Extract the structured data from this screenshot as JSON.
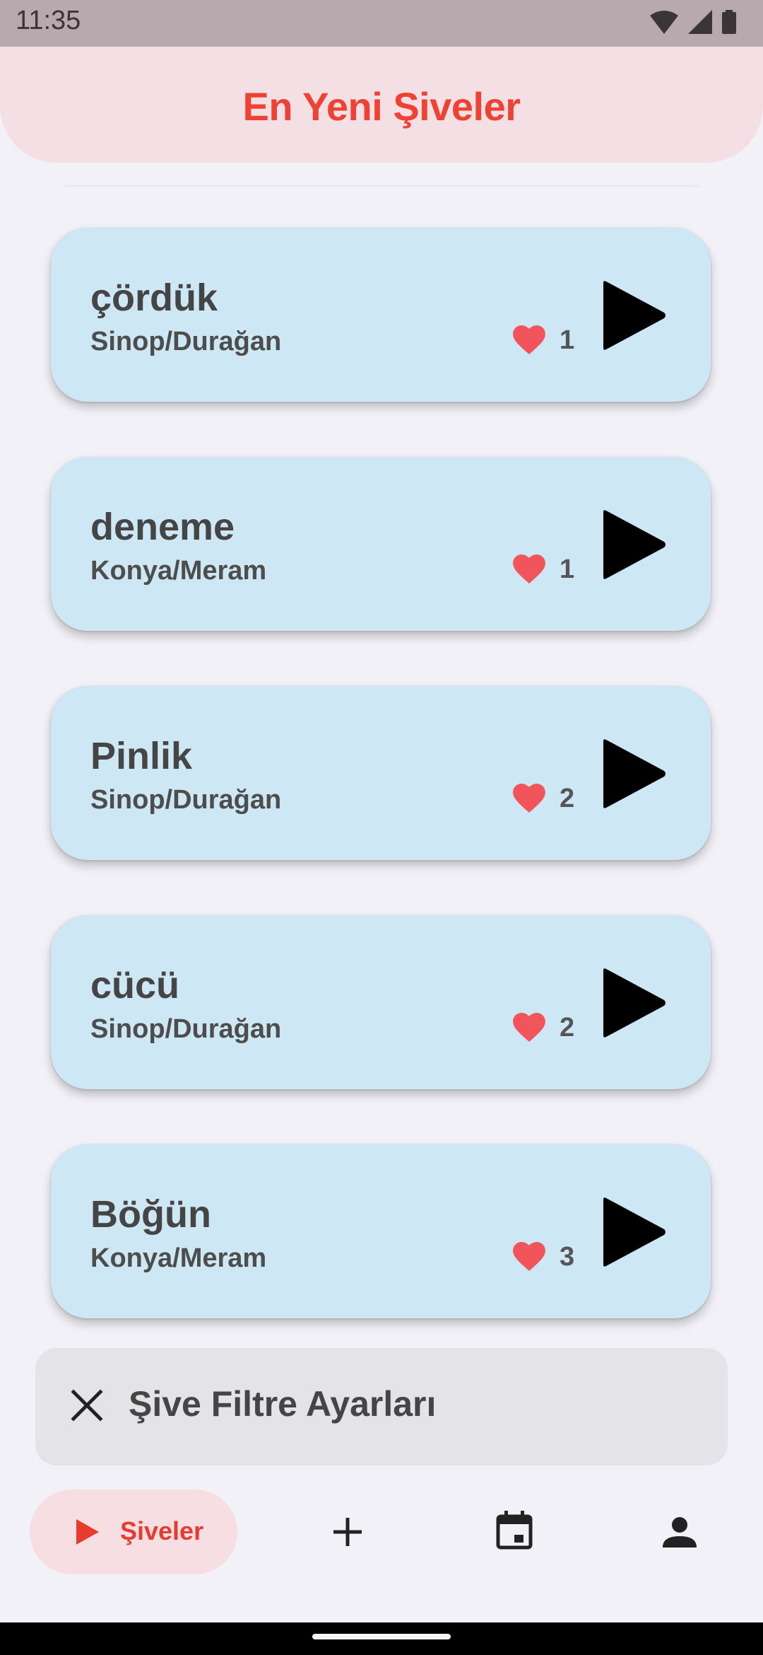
{
  "status_bar": {
    "time": "11:35"
  },
  "app_bar": {
    "title": "En Yeni Şiveler"
  },
  "cards": [
    {
      "word": "çördük",
      "location": "Sinop/Durağan",
      "likes": "1"
    },
    {
      "word": "deneme",
      "location": "Konya/Meram",
      "likes": "1"
    },
    {
      "word": "Pinlik",
      "location": "Sinop/Durağan",
      "likes": "2"
    },
    {
      "word": "cücü",
      "location": "Sinop/Durağan",
      "likes": "2"
    },
    {
      "word": "Böğün",
      "location": "Konya/Meram",
      "likes": "3"
    }
  ],
  "filter": {
    "label": "Şive Filtre Ayarları",
    "icon": "close-icon"
  },
  "bottom_nav": {
    "active_label": "Şiveler",
    "items": [
      "play-icon",
      "add-icon",
      "calendar-icon",
      "person-icon"
    ]
  },
  "colors": {
    "accent": "#EF4232",
    "card_bg": "#CDE7F4",
    "heart": "#F2545B",
    "app_bar_bg": "#F3DFE4"
  }
}
